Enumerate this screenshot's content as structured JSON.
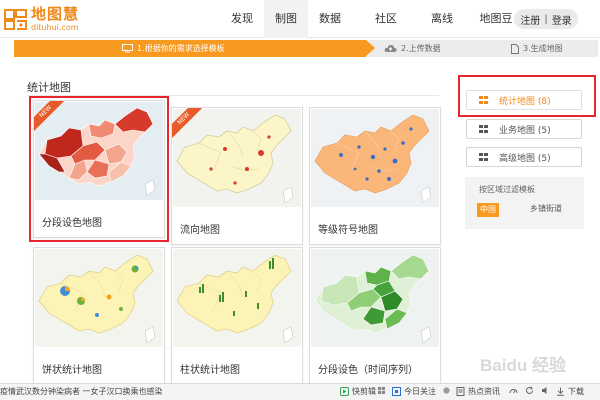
{
  "logo": {
    "name": "地图慧",
    "url": "dituhui.com"
  },
  "nav": [
    {
      "label": "发现",
      "active": false
    },
    {
      "label": "制图",
      "active": true
    },
    {
      "label": "数据",
      "active": false
    },
    {
      "label": "社区",
      "active": false
    },
    {
      "label": "离线",
      "active": false
    },
    {
      "label": "地图豆",
      "active": false
    }
  ],
  "auth": {
    "register": "注册",
    "separator": "|",
    "login": "登录"
  },
  "steps": [
    {
      "label": "1.根据你的需求选择模板",
      "active": true
    },
    {
      "label": "2.上传数据",
      "active": false
    },
    {
      "label": "3.生成地图",
      "active": false
    }
  ],
  "section": {
    "title": "统计地图"
  },
  "cards": [
    {
      "label": "分段设色地图",
      "badge": "NEW",
      "selected": true
    },
    {
      "label": "流向地图",
      "badge": "NEW",
      "selected": false
    },
    {
      "label": "等级符号地图",
      "badge": "",
      "selected": false
    },
    {
      "label": "饼状统计地图",
      "badge": "",
      "selected": false
    },
    {
      "label": "柱状统计地图",
      "badge": "",
      "selected": false
    },
    {
      "label": "分段设色（时间序列）",
      "badge": "",
      "selected": false
    }
  ],
  "categories": [
    {
      "label": "统计地图 (8)",
      "active": true
    },
    {
      "label": "业务地图 (5)",
      "active": false
    },
    {
      "label": "高级地图 (5)",
      "active": false
    }
  ],
  "filter": {
    "title": "按区域过滤模板",
    "china": "中国",
    "town": "乡镇街道"
  },
  "bottombar": {
    "news": "疫情武汉数分钟染病者 一女子汉口换乘也感染",
    "items": [
      "快剪辑",
      "今日关注",
      "热点资讯",
      "下载"
    ]
  },
  "watermark": {
    "text": "Baidu 经验"
  },
  "colors": {
    "accent": "#f89a20",
    "selection_outline": "#e8262e",
    "step_inactive_bg": "#ececec"
  }
}
